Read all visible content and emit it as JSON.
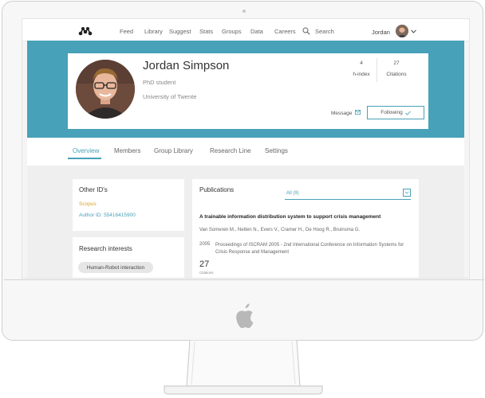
{
  "nav": {
    "items": [
      "Feed",
      "Library",
      "Suggest",
      "Stats",
      "Groups",
      "Data",
      "Careers"
    ],
    "search_label": "Search",
    "user_name": "Jordan"
  },
  "profile": {
    "name": "Jordan Simpson",
    "role": "PhD student",
    "institution": "University of Twente",
    "h_index_value": "4",
    "h_index_label": "h-index",
    "citations_value": "27",
    "citations_label": "Citations",
    "message_label": "Message",
    "following_label": "Following"
  },
  "tabs": {
    "items": [
      "Overview",
      "Members",
      "Group Library",
      "Research Line",
      "Settings"
    ],
    "active": "Overview"
  },
  "other_ids": {
    "title": "Other ID's",
    "scopus_label": "Scopus",
    "author_id": "Author ID: 55416415900"
  },
  "research_interests": {
    "title": "Research interests",
    "chips": [
      "Human-Robot interaction"
    ]
  },
  "publications": {
    "title": "Publications",
    "filter_value": "All (9)",
    "items": [
      {
        "title": "A trainable information distribution system to support crisis management",
        "authors": "Van Someren M., Netten N., Evers V., Cramer H., De Hoog R., Bruinsma G.",
        "year": "2005",
        "venue": "Proceedings of ISCRAM 2005 - 2nd International Conference on Information Systems for Crisis Response and Management",
        "citations": "27",
        "citations_label": "Citations"
      }
    ]
  },
  "colors": {
    "accent": "#47a1b8",
    "scopus": "#d9a020"
  }
}
